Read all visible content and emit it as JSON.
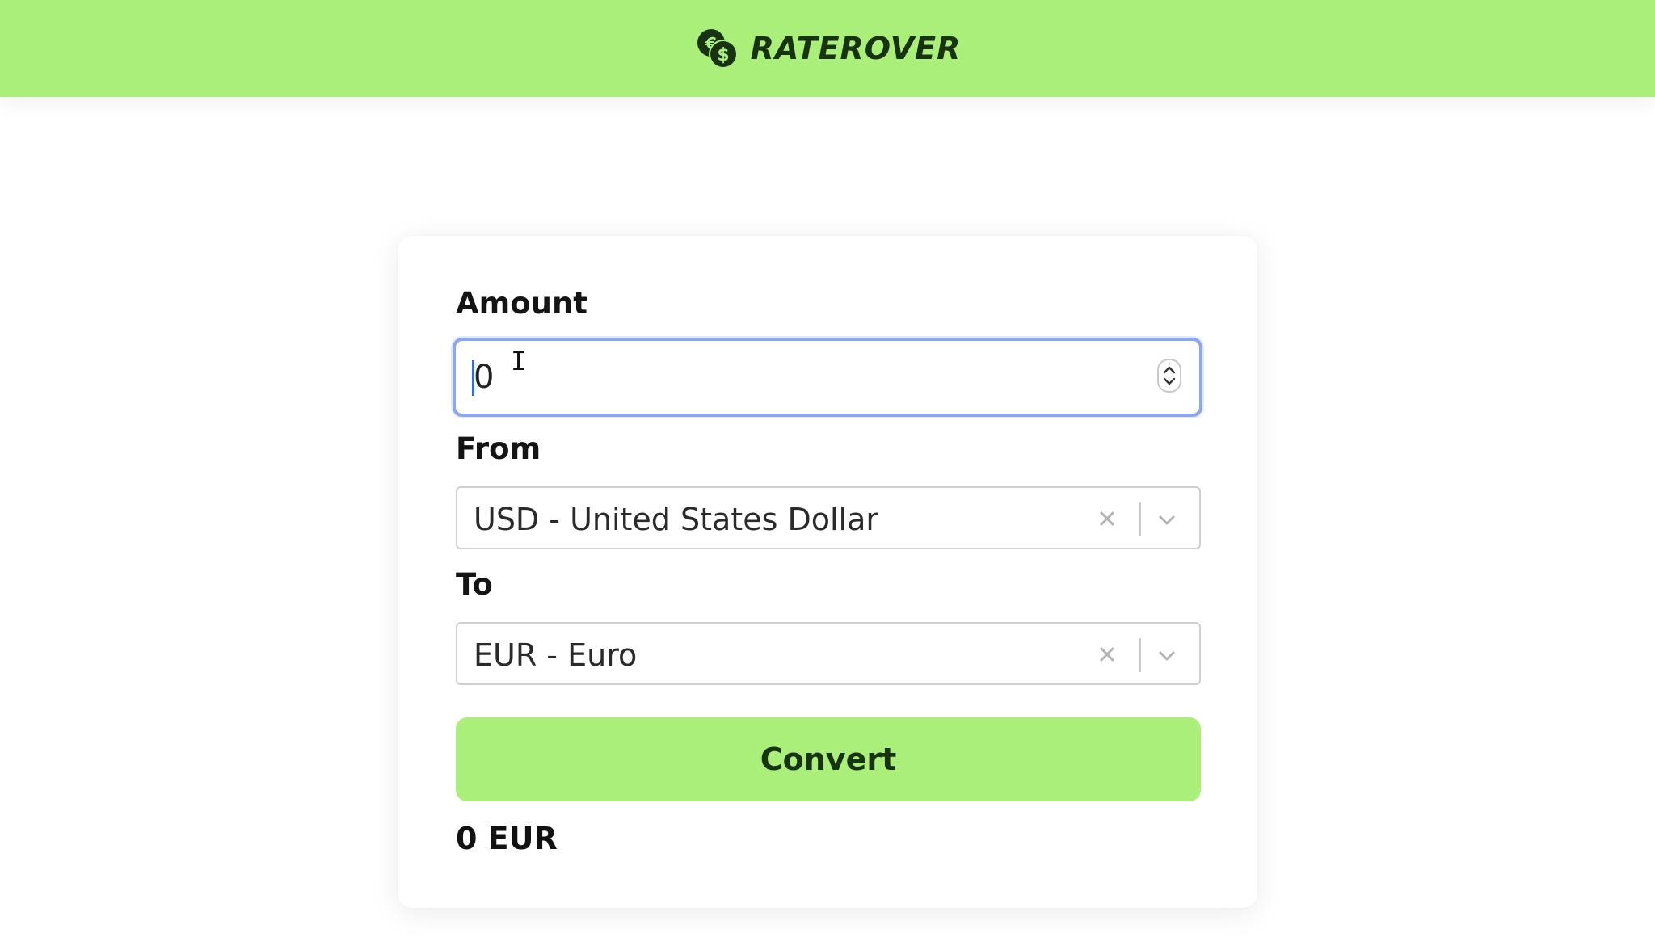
{
  "header": {
    "brand_name": "RATEROVER",
    "background": "#abef7b",
    "logo_icon": "euro-dollar-coins-icon"
  },
  "form": {
    "amount": {
      "label": "Amount",
      "value": "0"
    },
    "from": {
      "label": "From",
      "selected": "USD - United States Dollar"
    },
    "to": {
      "label": "To",
      "selected": "EUR - Euro"
    },
    "convert_label": "Convert",
    "result": "0 EUR"
  },
  "colors": {
    "accent": "#abef7b",
    "focus_ring": "#8aa8f0"
  }
}
